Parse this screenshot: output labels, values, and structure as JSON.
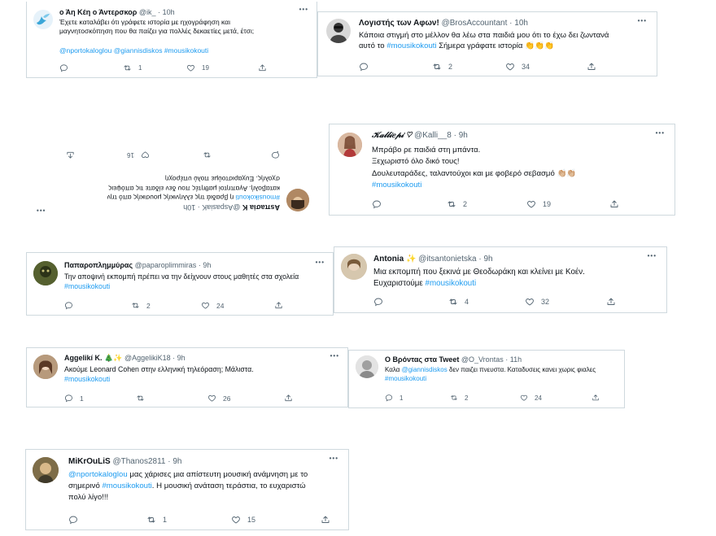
{
  "icons": {
    "more": "more-icon",
    "reply": "reply-icon",
    "retweet": "retweet-icon",
    "like": "like-icon",
    "share": "share-icon"
  },
  "colors": {
    "link": "#1d9bf0",
    "muted": "#536471",
    "border": "#cfd9de"
  },
  "tweets": {
    "t1": {
      "name": "ο Άη Κέη ο Άντερσκορ",
      "handle": "@ik_",
      "time": "10h",
      "more": "•••",
      "line1": "Έχετε καταλάβει ότι γράφετε ιστορία με ηχογράφηση και",
      "line2": "μαγνητοσκόπηση που θα παίζει για πολλές δεκαετίες μετά, έτσι;",
      "mention1": "@nportokaloglou",
      "mention2": "@giannisdiskos",
      "tag": "#mousikokouti",
      "retweets": "1",
      "likes": "19"
    },
    "t2": {
      "name": "Λογιστής των Αφων!",
      "handle": "@BrosAccountant",
      "time": "10h",
      "more": "•••",
      "line1": "Κάποια στιγμή στο μέλλον θα λέω στα παιδιά μου ότι το έχω δει ζωντανά",
      "pre": "αυτό το",
      "tag": "#mousikokouti",
      "post": "Σήμερα γράφατε ιστορία 👏👏👏",
      "retweets": "2",
      "likes": "34"
    },
    "t3": {
      "name": "Αsπaσia K",
      "handle": "@AspasiaK",
      "time": "10h",
      "more": "•••",
      "tag": "#mousikokouti",
      "line1rest": "η βραδιά της ελληνικής μουσικής από την",
      "line2": "καταβολή. Αγαπητοί μαθητές που δεν είδατε τις απόψεις",
      "line3": "σχολής. Ευχαριστούμε πολύ υπέροχη",
      "likes": "16"
    },
    "t4": {
      "name": "𝒦𝒶𝓁𝓁𝒾𝑒𝓅𝒾 ♡",
      "handle": "@Kalli__8",
      "time": "9h",
      "more": "•••",
      "line1": "Μπράβο ρε παιδιά στη μπάντα.",
      "line2": "Ξεχωριστό όλο δικό τους!",
      "line3": "Δουλευταράδες, ταλαντούχοι και με φοβερό σεβασμό 👏🏼👏🏼",
      "tag": "#mousikokouti",
      "retweets": "2",
      "likes": "19"
    },
    "t5": {
      "name": "Παπαροπλημμύρας",
      "handle": "@paparoplimmiras",
      "time": "9h",
      "more": "•••",
      "line1": "Την αποψινή εκπομπή πρέπει να την δείχνουν στους μαθητές στα σχολεία",
      "tag": "#mousikokouti",
      "retweets": "2",
      "likes": "24"
    },
    "t6": {
      "name": "Antonia ✨",
      "handle": "@itsantonietska",
      "time": "9h",
      "more": "•••",
      "line1": "Μια εκπομπή που ξεκινά με Θεοδωράκη και κλείνει με Κοέν.",
      "pre": "Ευχαριστούμε",
      "tag": "#mousikokouti",
      "retweets": "4",
      "likes": "32"
    },
    "t7": {
      "name": "Aggelikí K. 🎄✨",
      "handle": "@AggelikiK18",
      "time": "9h",
      "more": "•••",
      "line1": "Ακούμε Leonard Cohen στην ελληνική τηλεόραση; Μάλιστα.",
      "tag": "#mousikokouti",
      "replies": "1",
      "likes": "26"
    },
    "t8": {
      "name": "Ο Βρόντας στα Tweet",
      "handle": "@O_Vrontas",
      "time": "11h",
      "more": "•••",
      "pre": "Καλα",
      "mention": "@giannisdiskos",
      "post": "δεν παιζει πνευστα. Καταδυσεις κανει χωρις φιαλες",
      "tag": "#mousikokouti",
      "replies": "1",
      "retweets": "2",
      "likes": "24"
    },
    "t9": {
      "name": "MiKrOuLiS",
      "handle": "@Thanos2811",
      "time": "9h",
      "more": "•••",
      "mention": "@nportokaloglou",
      "line1rest": "μας χάρισες μια απίστευτη μουσική ανάμνηση με το",
      "pre2": "σημερινό",
      "tag": "#mousikokouti",
      "post2": ". Η μουσική ανάταση τεράστια, το ευχαριστώ",
      "line3": "πολύ λίγο!!!",
      "retweets": "1",
      "likes": "15"
    }
  }
}
